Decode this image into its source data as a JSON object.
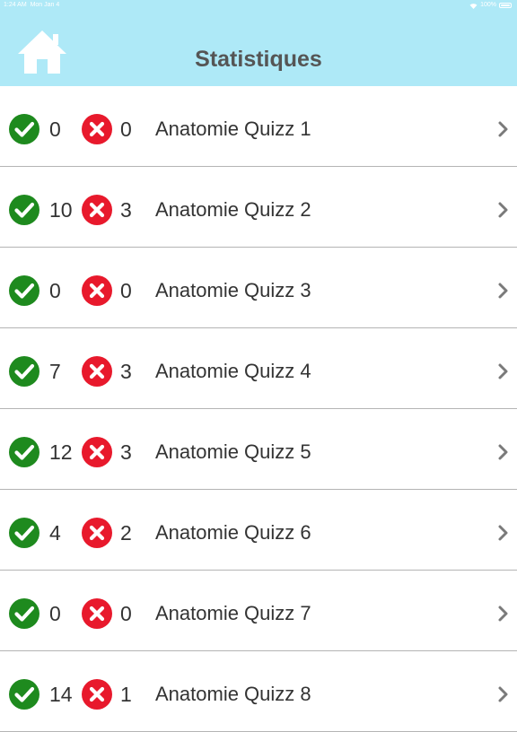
{
  "status_bar": {
    "time": "1:24 AM",
    "date": "Mon Jan 4",
    "battery": "100%"
  },
  "header": {
    "title": "Statistiques",
    "home_icon": "home-icon"
  },
  "colors": {
    "header_bg": "#aee9f7",
    "correct": "#1e8a1e",
    "wrong": "#e8192c",
    "divider": "#b4b4b4",
    "chevron": "#7a7a7a"
  },
  "quizzes": [
    {
      "label": "Anatomie Quizz 1",
      "correct": "0",
      "wrong": "0"
    },
    {
      "label": "Anatomie Quizz 2",
      "correct": "10",
      "wrong": "3"
    },
    {
      "label": "Anatomie Quizz 3",
      "correct": "0",
      "wrong": "0"
    },
    {
      "label": "Anatomie Quizz 4",
      "correct": "7",
      "wrong": "3"
    },
    {
      "label": "Anatomie Quizz 5",
      "correct": "12",
      "wrong": "3"
    },
    {
      "label": "Anatomie Quizz 6",
      "correct": "4",
      "wrong": "2"
    },
    {
      "label": "Anatomie Quizz 7",
      "correct": "0",
      "wrong": "0"
    },
    {
      "label": "Anatomie Quizz 8",
      "correct": "14",
      "wrong": "1"
    }
  ]
}
